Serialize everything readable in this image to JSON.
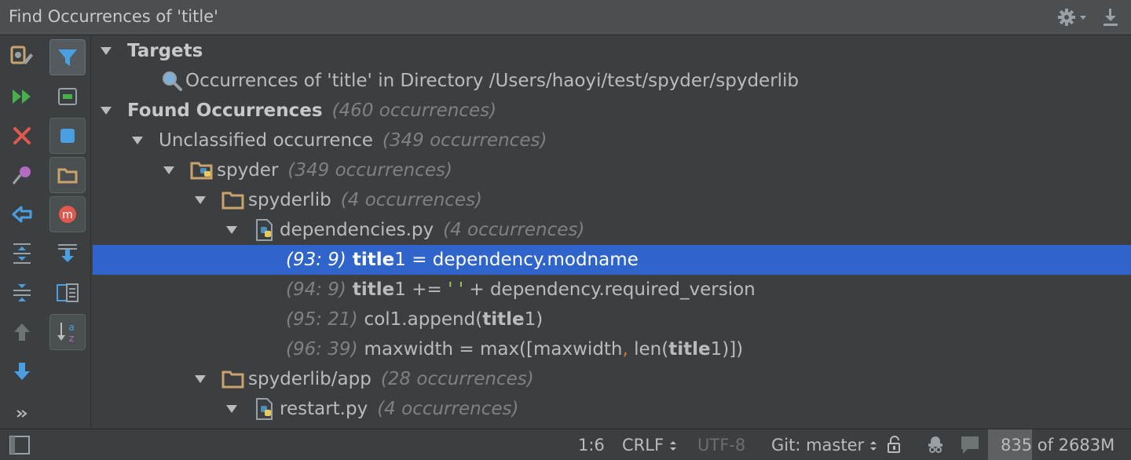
{
  "window": {
    "title": "Find Occurrences of 'title'"
  },
  "toolbar_left": [
    "rerun-settings-icon",
    "rerun-icon",
    "close-icon",
    "pin-icon",
    "previous-occurrence-icon",
    "expand-all-icon",
    "collapse-all-icon",
    "up-arrow-icon",
    "down-arrow-icon",
    "more-chevron-icon"
  ],
  "toolbar_right": [
    "filter-icon",
    "preview-icon",
    "group-by-module-icon",
    "group-by-directory-icon",
    "group-by-method-icon",
    "autoscroll-icon",
    "export-icon",
    "sort-alpha-icon"
  ],
  "tree": {
    "targets_label": "Targets",
    "target_item": "Occurrences of 'title' in Directory /Users/haoyi/test/spyder/spyderlib",
    "found_label": "Found Occurrences",
    "found_count": "(460 occurrences)",
    "unclassified_label": "Unclassified occurrence",
    "unclassified_count": "(349 occurrences)",
    "spyder_label": "spyder",
    "spyder_count": "(349 occurrences)",
    "spyderlib_label": "spyderlib",
    "spyderlib_count": "(4 occurrences)",
    "deps_label": "dependencies.py",
    "deps_count": "(4 occurrences)",
    "occ1": {
      "ref": "(93: 9)",
      "hl": "title",
      "rest": "1 = dependency.modname"
    },
    "occ2": {
      "ref": "(94: 9)",
      "hl": "title",
      "mid": "1 += ",
      "str": "' '",
      "rest": " + dependency.required_version"
    },
    "occ3": {
      "ref": "(95: 21)",
      "pre": "col1.append(",
      "hl": "title",
      "rest": "1)"
    },
    "occ4": {
      "ref": "(96: 39)",
      "pre": "maxwidth = max([maxwidth",
      "comma": ",",
      "mid": " len(",
      "hl": "title",
      "rest": "1)])"
    },
    "app_label": "spyderlib/app",
    "app_count": "(28 occurrences)",
    "restart_label": "restart.py",
    "restart_count": "(4 occurrences)"
  },
  "status": {
    "position": "1:6",
    "line_sep": "CRLF",
    "encoding": "UTF-8",
    "git": "Git: master",
    "memory_text": "835 of 2683M",
    "memory_used_fraction": 0.31
  },
  "colors": {
    "selection": "#2f65ca",
    "background": "#3c3f41",
    "folder": "#c9a36b",
    "python_blue": "#4a8ec2",
    "python_yellow": "#e8c95b"
  }
}
